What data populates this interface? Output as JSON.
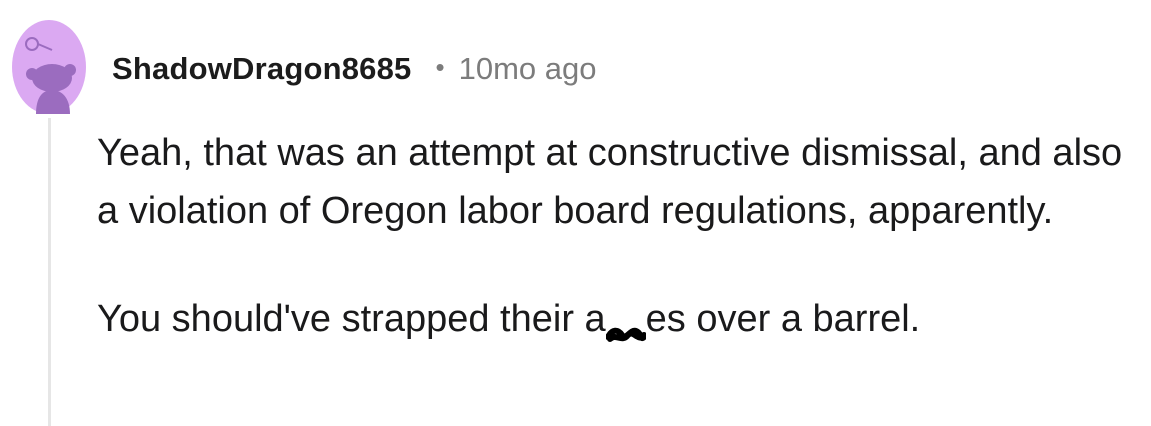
{
  "comment": {
    "avatar_icon": "reddit-snoo-avatar-icon",
    "avatar_bg_color": "#dba9f2",
    "avatar_fg_color": "#9b6cbf",
    "username": "ShadowDragon8685",
    "separator": "•",
    "timestamp": "10mo ago",
    "paragraph_1": "Yeah, that was an attempt at constructive dismissal, and also a violation of Oregon labor board regulations, apparently.",
    "paragraph_2_before": "You should've strapped their a",
    "redaction_icon": "scribble-redaction-icon",
    "paragraph_2_after": "es over a barrel."
  }
}
